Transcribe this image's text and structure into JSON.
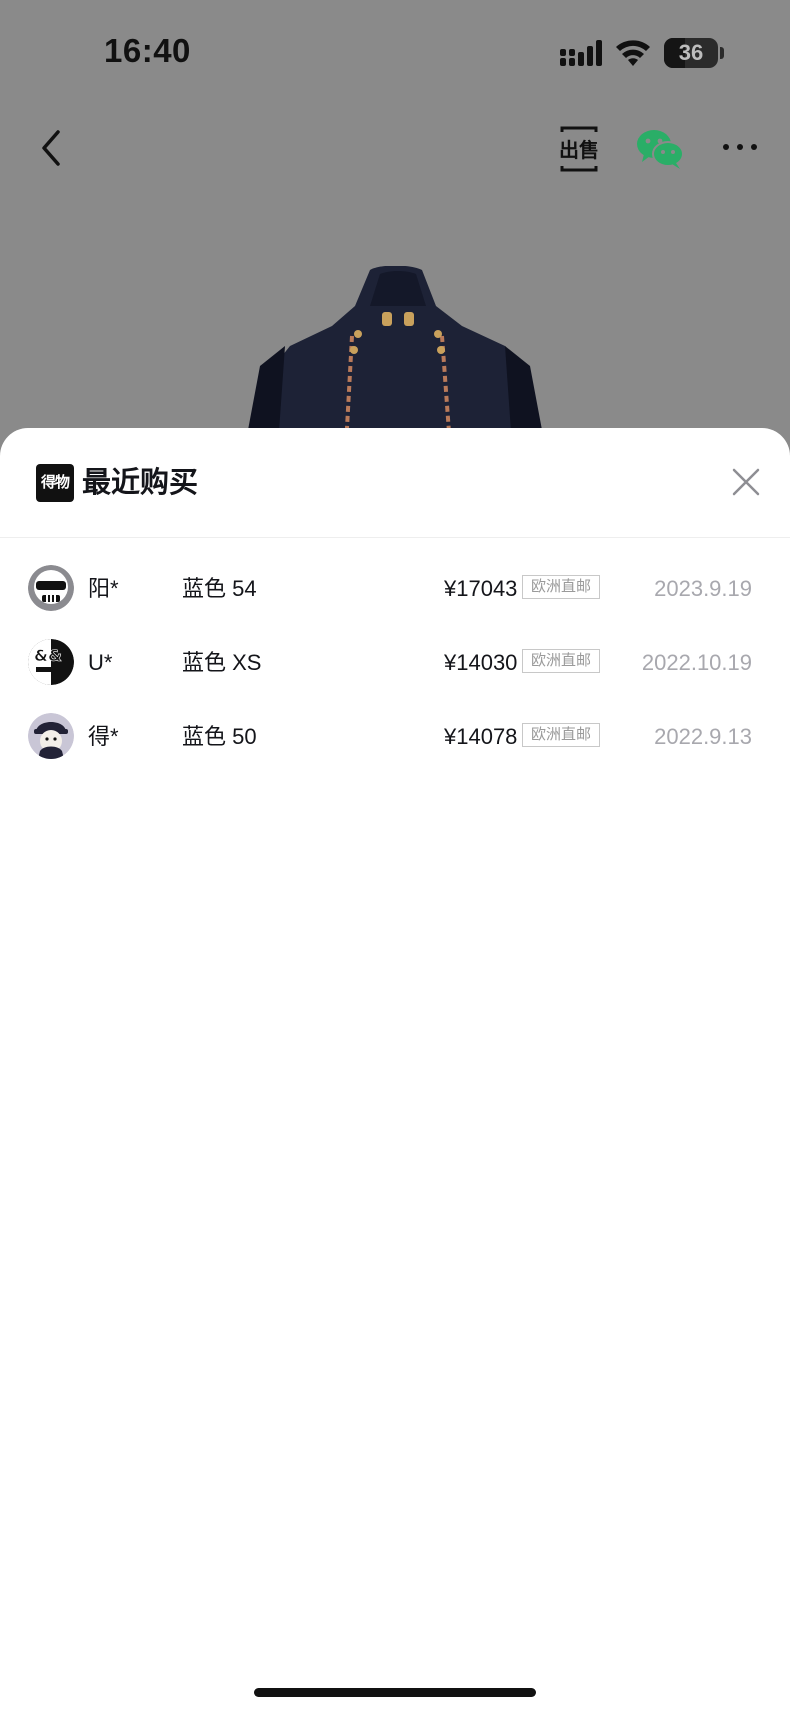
{
  "status_bar": {
    "time": "16:40",
    "battery_level": "36",
    "icons": [
      "signal-icon",
      "wifi-icon",
      "battery-icon"
    ]
  },
  "nav": {
    "icons": [
      "back-icon",
      "sell-icon",
      "wechat-icon",
      "more-icon"
    ],
    "sell_label": "出售"
  },
  "sheet": {
    "logo_text": "得物",
    "title": "最近购买",
    "close_icon": "close-icon"
  },
  "purchases": [
    {
      "name": "阳*",
      "variant": "蓝色 54",
      "price": "¥17043",
      "shipping": "欧洲直邮",
      "date": "2023.9.19",
      "avatar": "skull-sunglasses-avatar"
    },
    {
      "name": "U*",
      "variant": "蓝色 XS",
      "price": "¥14030",
      "shipping": "欧洲直邮",
      "date": "2022.10.19",
      "avatar": "ampersand-avatar"
    },
    {
      "name": "得*",
      "variant": "蓝色 50",
      "price": "¥14078",
      "shipping": "欧洲直邮",
      "date": "2022.9.13",
      "avatar": "cartoon-cap-avatar"
    }
  ],
  "colors": {
    "backdrop": "#8a8a8a",
    "wechat_green": "#2aae67",
    "jacket_navy": "#1d2236",
    "date_gray": "#a8a8ae"
  }
}
